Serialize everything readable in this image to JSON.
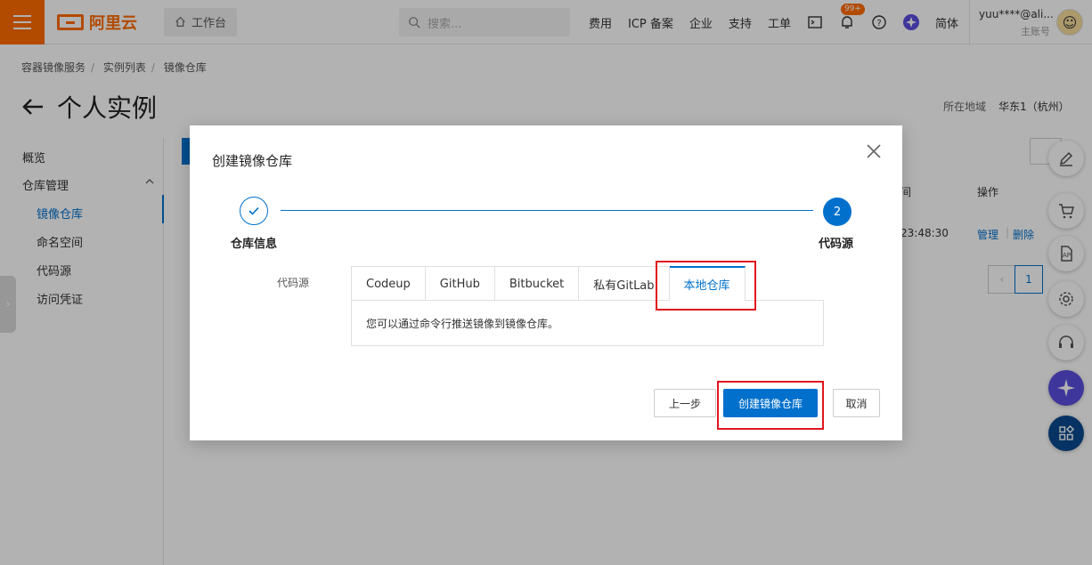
{
  "topbar": {
    "logo_text": "阿里云",
    "workbench": "工作台",
    "search_placeholder": "搜索...",
    "links": [
      "费用",
      "ICP 备案",
      "企业",
      "支持",
      "工单"
    ],
    "notification_badge": "99+",
    "language": "简体",
    "account_name": "yuu****@ali...",
    "account_type": "主账号"
  },
  "breadcrumb": [
    "容器镜像服务",
    "实例列表",
    "镜像仓库"
  ],
  "page": {
    "title": "个人实例",
    "region_label": "所在地域",
    "region_value": "华东1（杭州）"
  },
  "sidenav": {
    "overview": "概览",
    "repo_mgmt": "仓库管理",
    "items": [
      "镜像仓库",
      "命名空间",
      "代码源",
      "访问凭证"
    ]
  },
  "background_table": {
    "col_time": "间",
    "col_ops": "操作",
    "row_time": "23:48:30",
    "manage": "管理",
    "delete": "删除",
    "page_num": "1"
  },
  "dialog": {
    "title": "创建镜像仓库",
    "step1_label": "仓库信息",
    "step2_number": "2",
    "step2_label": "代码源",
    "field_label": "代码源",
    "tabs": [
      "Codeup",
      "GitHub",
      "Bitbucket",
      "私有GitLab",
      "本地仓库"
    ],
    "active_tab": "本地仓库",
    "tab_content": "您可以通过命令行推送镜像到镜像仓库。",
    "btn_prev": "上一步",
    "btn_create": "创建镜像仓库",
    "btn_cancel": "取消"
  },
  "colors": {
    "brand": "#ff6a00",
    "primary": "#0070cc",
    "highlight": "#e0161e"
  }
}
